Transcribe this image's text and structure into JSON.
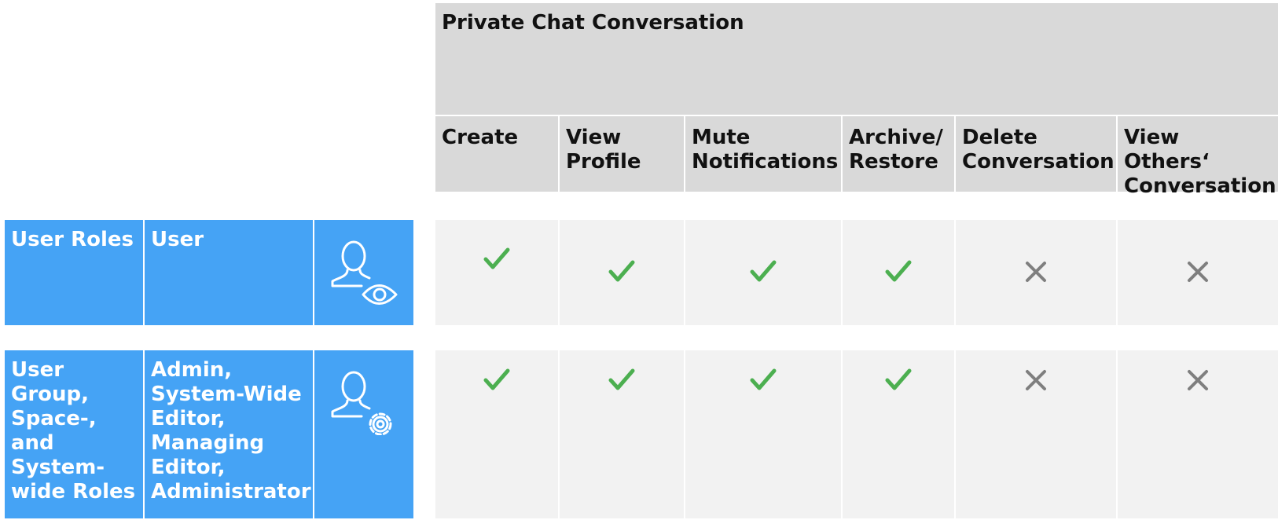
{
  "table": {
    "group_header": "Private Chat Conversation",
    "columns": [
      "Create",
      "View Profile",
      "Mute Notifications",
      "Archive/ Restore",
      "Delete Conversation",
      "View Others‘ Conversation"
    ],
    "rows": [
      {
        "category": "User Roles",
        "roles": "User",
        "icon": "user-view-icon",
        "permissions": [
          true,
          true,
          true,
          true,
          false,
          false
        ]
      },
      {
        "category": "User Group, Space-, and System-wide Roles",
        "roles": "Admin, System-Wide Editor, Managing Editor, Administrator",
        "icon": "user-settings-icon",
        "permissions": [
          true,
          true,
          true,
          true,
          false,
          false
        ]
      }
    ]
  },
  "colors": {
    "role_background": "#45a3f5",
    "header_background": "#d9d9d9",
    "cell_background": "#f2f2f2",
    "allowed_check": "#4caf50",
    "denied_cross": "#7f7f7f"
  }
}
